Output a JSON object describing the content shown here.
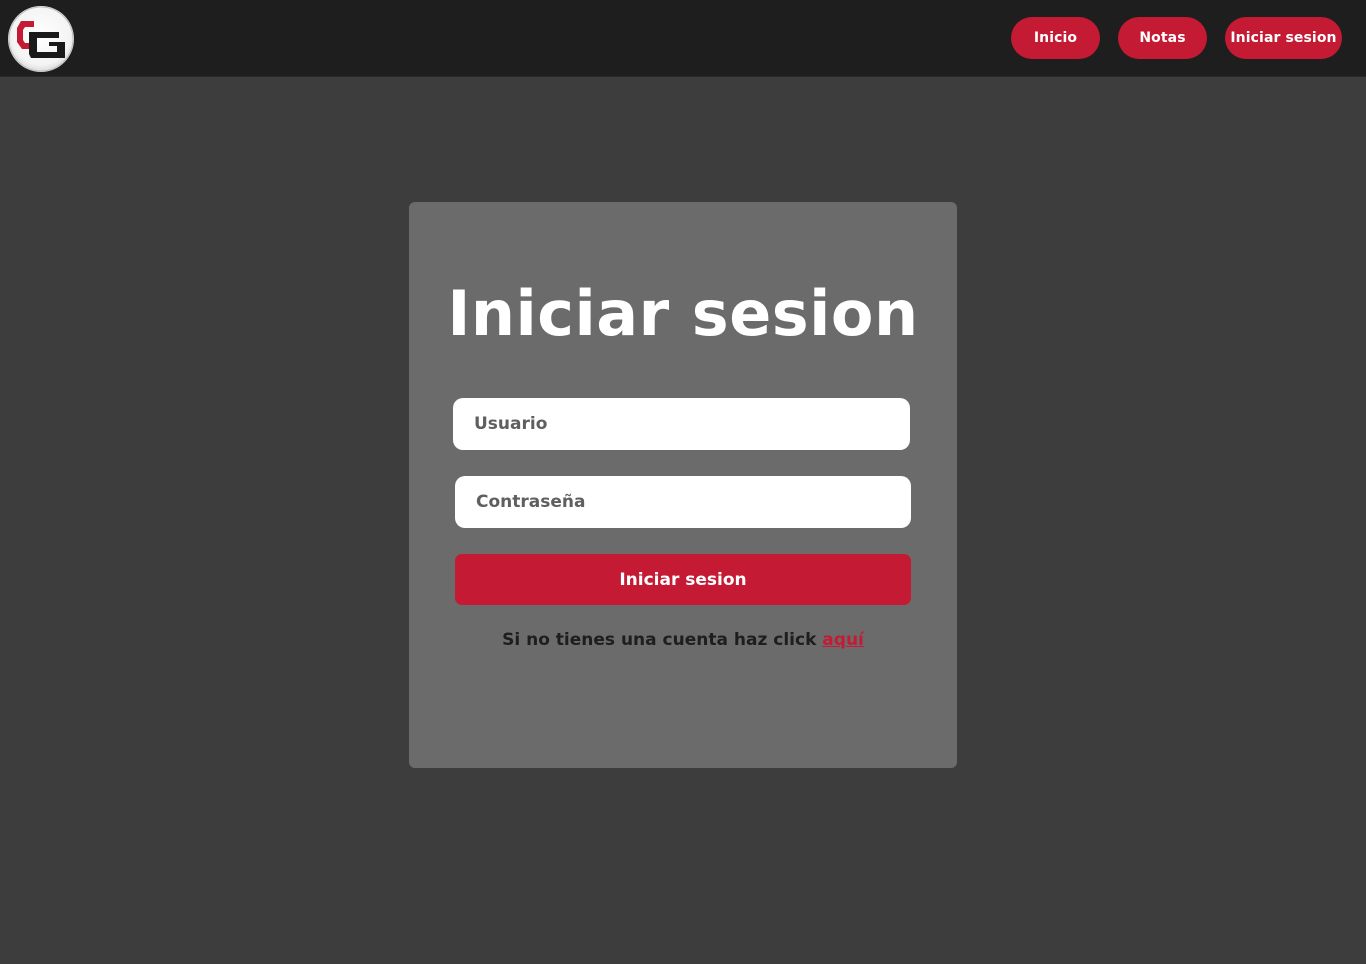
{
  "theme": {
    "accent": "#c41a33",
    "navbar_bg": "#1e1e1e",
    "page_bg": "#3d3d3d",
    "card_bg": "#6b6b6b"
  },
  "header": {
    "logo_icon": "cg-logo-icon",
    "nav": {
      "inicio": "Inicio",
      "notas": "Notas",
      "login": "Iniciar sesion"
    }
  },
  "login": {
    "title": "Iniciar sesion",
    "username_placeholder": "Usuario",
    "password_placeholder": "Contraseña",
    "submit_label": "Iniciar sesion",
    "register_text": "Si no tienes una cuenta haz click ",
    "register_link": "aquí"
  }
}
